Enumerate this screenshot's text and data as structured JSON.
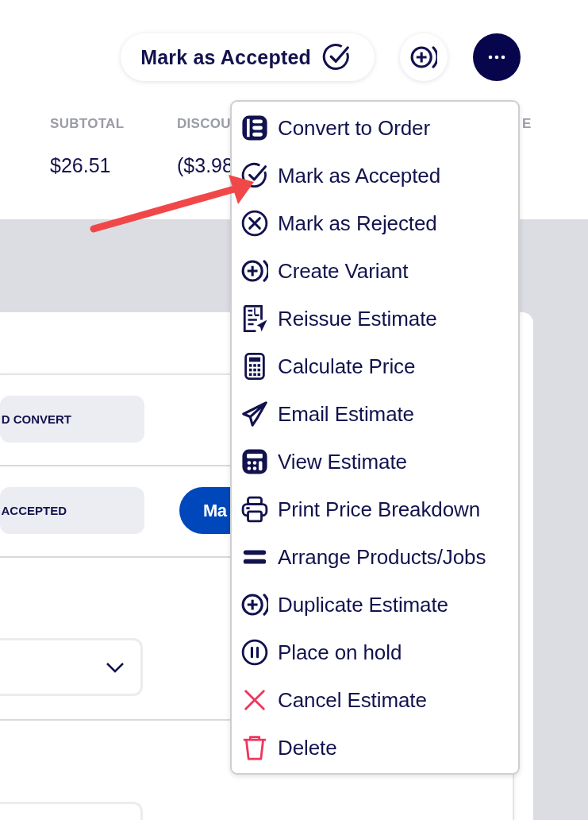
{
  "header_actions": {
    "accept_button": "Mark as Accepted"
  },
  "summary": [
    {
      "label": "SUBTOTAL",
      "value": "$26.51"
    },
    {
      "label": "DISCOU",
      "value": "($3.98"
    },
    {
      "label": "E"
    }
  ],
  "panel": {
    "convert_button": "D CONVERT",
    "accepted_button": "ACCEPTED",
    "primary_button": "Ma"
  },
  "menu": [
    {
      "label": "Convert to Order"
    },
    {
      "label": "Mark as Accepted"
    },
    {
      "label": "Mark as Rejected"
    },
    {
      "label": "Create Variant"
    },
    {
      "label": "Reissue Estimate"
    },
    {
      "label": "Calculate Price"
    },
    {
      "label": "Email Estimate"
    },
    {
      "label": "View Estimate"
    },
    {
      "label": "Print Price Breakdown"
    },
    {
      "label": "Arrange Products/Jobs"
    },
    {
      "label": "Duplicate Estimate"
    },
    {
      "label": "Place on hold"
    },
    {
      "label": "Cancel Estimate"
    },
    {
      "label": "Delete"
    }
  ]
}
